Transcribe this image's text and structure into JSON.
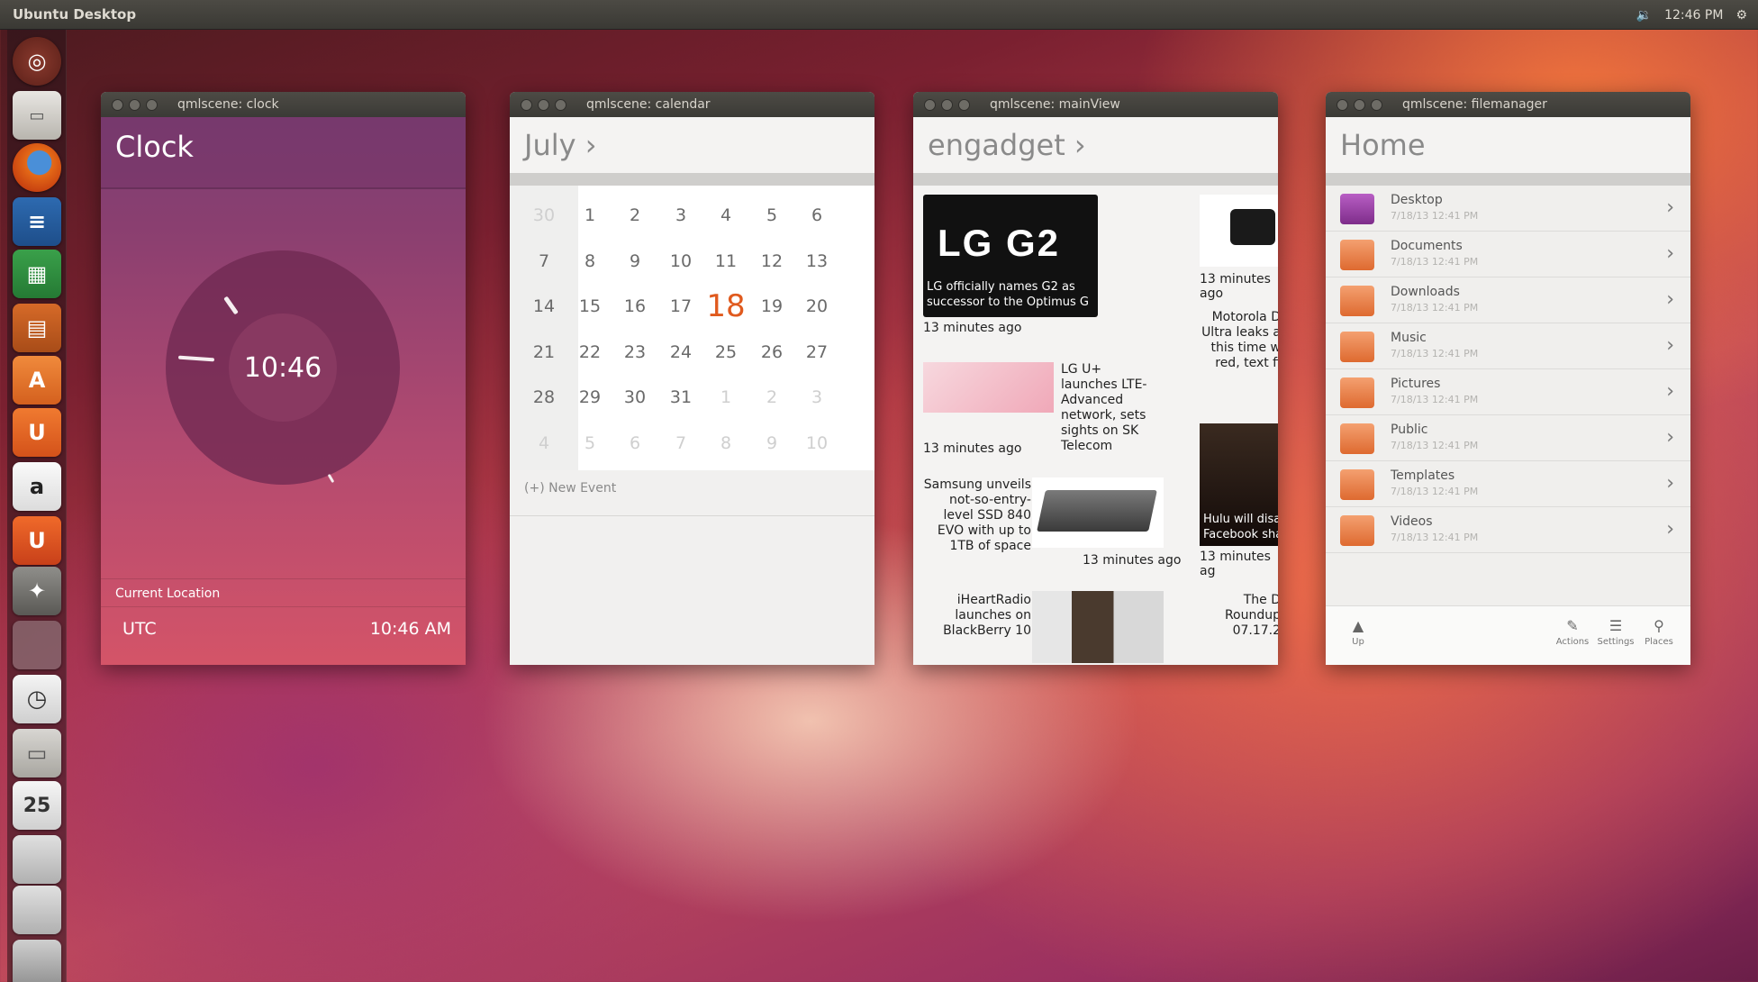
{
  "topbar": {
    "title": "Ubuntu Desktop",
    "volume_icon": "speaker-icon",
    "time": "12:46 PM",
    "settings_icon": "gear-icon"
  },
  "launcher": {
    "icons": [
      "ubuntu-logo-icon",
      "files-icon",
      "firefox-icon",
      "writer-icon",
      "calc-icon",
      "impress-icon",
      "software-center-icon",
      "ubuntu-one-icon",
      "amazon-icon",
      "ubuntu-one-music-icon",
      "system-settings-icon",
      "blank-app-icon",
      "clock-app-icon",
      "file-manager-icon",
      "calendar-app-icon",
      "drive-icon",
      "drive-icon",
      "trash-icon"
    ],
    "calendar_day": "25"
  },
  "clock_window": {
    "title": "qmlscene: clock",
    "header": "Clock",
    "dial_time": "10:46",
    "location_label": "Current Location",
    "zone": "UTC",
    "zone_time": "10:46 AM"
  },
  "calendar_window": {
    "title": "qmlscene: calendar",
    "month": "July ›",
    "weeks": [
      [
        "30",
        "1",
        "2",
        "3",
        "4",
        "5",
        "6"
      ],
      [
        "7",
        "8",
        "9",
        "10",
        "11",
        "12",
        "13"
      ],
      [
        "14",
        "15",
        "16",
        "17",
        "18",
        "19",
        "20"
      ],
      [
        "21",
        "22",
        "23",
        "24",
        "25",
        "26",
        "27"
      ],
      [
        "28",
        "29",
        "30",
        "31",
        "1",
        "2",
        "3"
      ],
      [
        "4",
        "5",
        "6",
        "7",
        "8",
        "9",
        "10"
      ]
    ],
    "today": "18",
    "new_event": "(+) New Event"
  },
  "news_window": {
    "title": "qmlscene: mainView",
    "header": "engadget ›",
    "articles": [
      {
        "caption": "LG officially names G2 as successor to the Optimus G",
        "time": "13 minutes ago",
        "thumb_text": "LG G2"
      },
      {
        "caption": "13 minutes ago",
        "time": ""
      },
      {
        "caption": "Motorola D Ultra leaks a this time w red, text fi",
        "time": ""
      },
      {
        "caption": "LG U+ launches LTE-Advanced network, sets sights on SK Telecom",
        "time": "13 minutes ago"
      },
      {
        "caption": "Samsung unveils not-so-entry-level SSD 840 EVO with up to 1TB of space",
        "time": "13 minutes ago"
      },
      {
        "caption": "Hulu will disa Facebook sha",
        "time": "13 minutes ag"
      },
      {
        "caption": "iHeartRadio launches on BlackBerry 10",
        "time": ""
      },
      {
        "caption": "The D Roundup 07.17.2",
        "time": ""
      }
    ]
  },
  "fm_window": {
    "title": "qmlscene: filemanager",
    "header": "Home",
    "folders": [
      {
        "name": "Desktop",
        "date": "7/18/13 12:41 PM",
        "color": "#9b3fa6"
      },
      {
        "name": "Documents",
        "date": "7/18/13 12:41 PM",
        "color": "#e8743a"
      },
      {
        "name": "Downloads",
        "date": "7/18/13 12:41 PM",
        "color": "#e8743a"
      },
      {
        "name": "Music",
        "date": "7/18/13 12:41 PM",
        "color": "#e8743a"
      },
      {
        "name": "Pictures",
        "date": "7/18/13 12:41 PM",
        "color": "#e8743a"
      },
      {
        "name": "Public",
        "date": "7/18/13 12:41 PM",
        "color": "#e8743a"
      },
      {
        "name": "Templates",
        "date": "7/18/13 12:41 PM",
        "color": "#e8743a"
      },
      {
        "name": "Videos",
        "date": "7/18/13 12:41 PM",
        "color": "#e8743a"
      }
    ],
    "toolbar": {
      "up": "Up",
      "actions": "Actions",
      "settings": "Settings",
      "places": "Places"
    }
  }
}
